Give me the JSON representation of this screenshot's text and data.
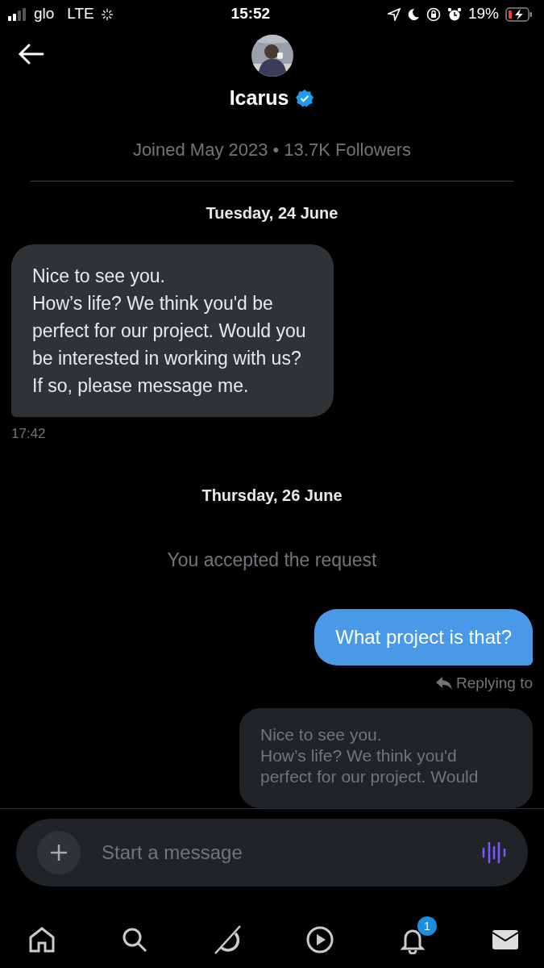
{
  "status_bar": {
    "carrier": "glo",
    "network": "LTE",
    "time": "15:52",
    "battery": "19%"
  },
  "header": {
    "name": "Icarus",
    "verified": true,
    "meta": "Joined May 2023 • 13.7K Followers"
  },
  "messages": [
    {
      "kind": "date",
      "text": "Tuesday, 24 June"
    },
    {
      "kind": "received",
      "text": "Nice to see you.\nHow’s life? We think you'd be perfect for our project. Would you be interested in working with us? If so, please message me.",
      "time": "17:42"
    },
    {
      "kind": "date",
      "text": "Thursday, 26 June"
    },
    {
      "kind": "notice",
      "text": "You accepted the request"
    },
    {
      "kind": "sent",
      "text": "What project is that?"
    },
    {
      "kind": "reply",
      "label": "Replying to",
      "quote": "Nice to see you.\nHow’s life? We think you'd\nperfect for our project. Would"
    }
  ],
  "composer": {
    "placeholder": "Start a message"
  },
  "tab_bar": [
    {
      "kind": "home",
      "selected": false
    },
    {
      "kind": "search",
      "selected": false
    },
    {
      "kind": "grok",
      "selected": false
    },
    {
      "kind": "video",
      "selected": false
    },
    {
      "kind": "notifications",
      "selected": false,
      "badge": "1"
    },
    {
      "kind": "messages",
      "selected": true
    }
  ]
}
